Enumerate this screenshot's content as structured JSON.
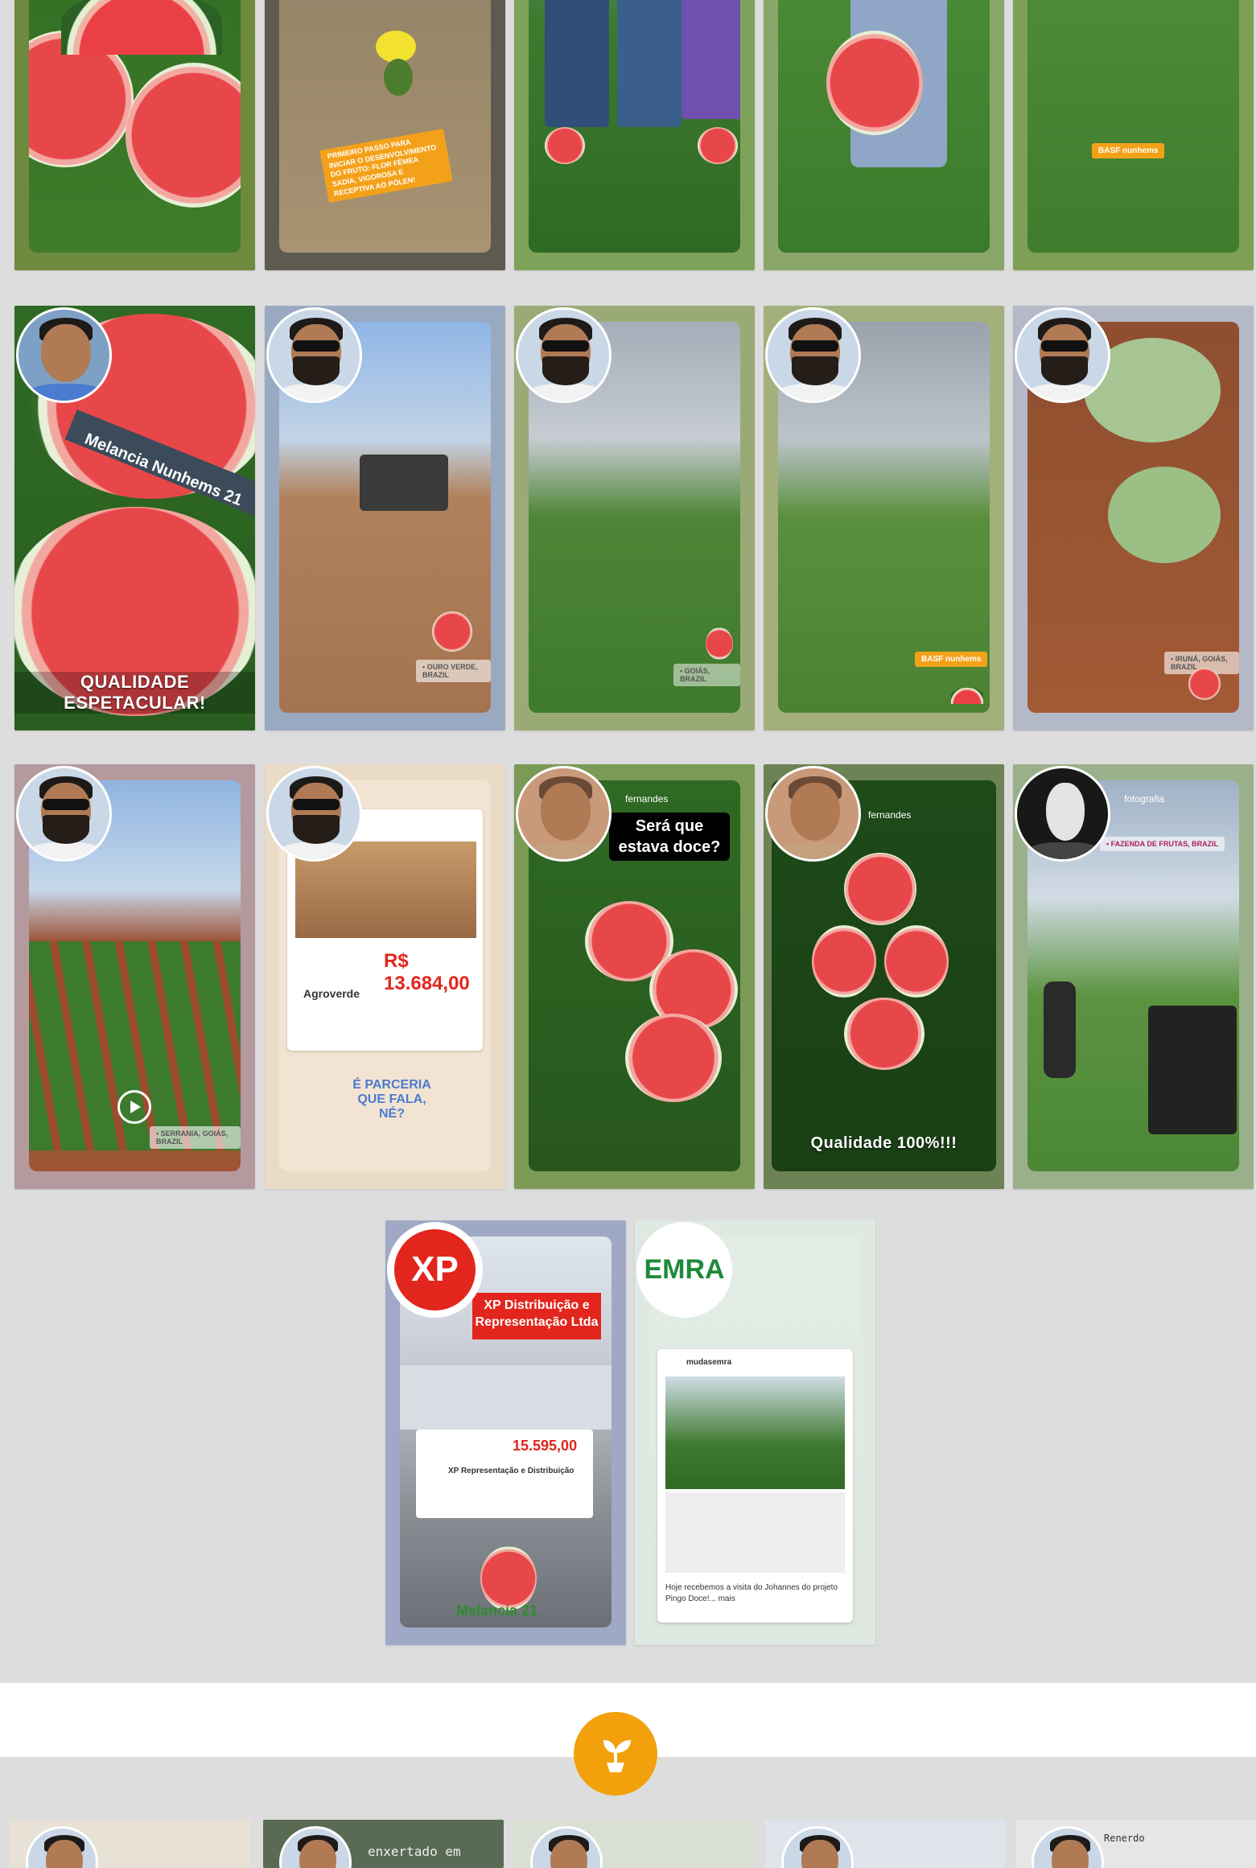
{
  "rows": [
    {
      "tiles": [
        {
          "frame": "#6d8a3e",
          "bg": "linear-gradient(180deg,#2e6a22 0%,#3f7d2a 100%)",
          "caption": ""
        },
        {
          "frame": "#5f5a4f",
          "bg": "linear-gradient(180deg,#8c7d62 0%,#a89372 100%)",
          "caption": "PRIMEIRO PASSO PARA INICIAR O DESENVOLVIMENTO DO FRUTO: FLOR FÊMEA SADIA, VIGOROSA E RECEPTIVA AO PÓLEN!"
        },
        {
          "frame": "#7fa25a",
          "bg": "linear-gradient(180deg,#7aa1c8 0%,#3e7a2e 40%,#2f6a25 100%)",
          "caption": ""
        },
        {
          "frame": "#8aa66a",
          "bg": "linear-gradient(180deg,#8fb6d8 0%,#4a8a34 35%,#3a7a2b 100%)",
          "caption": ""
        },
        {
          "frame": "#7ea055",
          "bg": "linear-gradient(180deg,#b9cde0 0%,#4f8d38 25%,#3f7c2d 100%)",
          "caption": "BASF nunhems"
        }
      ]
    },
    {
      "tiles": [
        {
          "frame": "#5f7a3a",
          "bg": "linear-gradient(180deg,#2f6a24 0%,#2a5e20 100%)",
          "caption": "QUALIDADE ESPETACULAR!",
          "sub": "Melancia Nunhems 21"
        },
        {
          "frame": "#9aa9c2",
          "bg": "linear-gradient(180deg,#8fb6e6 0%,#c2d3e6 30%,#b0815b 45%,#a47450 100%)",
          "caption": "",
          "loc": "• OURO VERDE, BRAZIL"
        },
        {
          "frame": "#9aaa76",
          "bg": "linear-gradient(180deg,#a4adb8 0%,#c6ccd2 30%,#4e8536 50%,#3e7a2c 100%)",
          "caption": "",
          "loc": "• GOIÁS, BRAZIL"
        },
        {
          "frame": "#a4b07c",
          "bg": "linear-gradient(180deg,#9aa3ad 0%,#bcc4cb 30%,#5a8f3c 50%,#4a8232 100%)",
          "caption": "",
          "loc": "BASF nunhems"
        },
        {
          "frame": "#b4b9c7",
          "bg": "linear-gradient(180deg,#8e4e2f 0%,#a35a35 100%)",
          "caption": "",
          "loc": "• IRUNÁ, GOIÁS, BRAZIL"
        }
      ]
    },
    {
      "tiles": [
        {
          "frame": "#b49a9e",
          "bg": "linear-gradient(180deg,#8fb4e0 0%,#c6d8ea 28%,#9b4c2d 42%,#3f7a30 60%,#a35334 100%)",
          "caption": "",
          "loc": "• SERRANIA, GOIÁS, BRAZIL"
        },
        {
          "frame": "#eadbc7",
          "bg": "linear-gradient(180deg,#f4e6d5 0%,#f3e3d2 100%)",
          "caption": "",
          "price": "R$ 13.684,00",
          "partner": "Agroverde",
          "slogan": "É PARCERIA QUE FALA, NÉ?"
        },
        {
          "frame": "#7a9a55",
          "bg": "linear-gradient(180deg,#2f6a24 0%,#27561d 100%)",
          "caption": "Será que estava doce?",
          "handle": "fernandes"
        },
        {
          "frame": "#6e8355",
          "bg": "linear-gradient(180deg,#1e4a18 0%,#1a3f15 100%)",
          "caption": "Qualidade 100%!!!",
          "handle": "fernandes"
        },
        {
          "frame": "#9ab08a",
          "bg": "linear-gradient(180deg,#9fb2c6 0%,#d1dbe4 30%,#5b9440 55%,#4b8734 100%)",
          "caption": "",
          "loc": "• FAZENDA DE FRUTAS, BRAZIL",
          "handle": "fotografia"
        }
      ]
    },
    {
      "tiles": [
        {
          "frame": "#9fa9c6",
          "bg": "linear-gradient(180deg,#dfe6ef 0%,#c9ced6 30%,#8a8f95 70%,#6b7076 100%)",
          "caption": "XP Distribuição e Representação Ltda",
          "price": "15.595,00",
          "partner": "XP Representação e Distribuição",
          "brand": "Melancia 21"
        },
        {
          "frame": "#dfe8e1",
          "bg": "linear-gradient(180deg,#e4ece6 0%,#dde6df 100%)",
          "caption": "",
          "handle": "mudasemra",
          "post": "Hoje recebemos a visita do Johannes do projeto Pingo Doce!... mais"
        }
      ]
    }
  ],
  "avatars": {
    "xp": "XP",
    "emra": "EMRA"
  },
  "bottom_row": {
    "labels": [
      "",
      "enxertado em",
      "",
      "",
      "Renerdo"
    ]
  },
  "badge_icon": "plant-sprout-icon",
  "colors": {
    "page_bg": "#dddddd",
    "band_bg": "#ffffff",
    "badge": "#f2a10c"
  }
}
